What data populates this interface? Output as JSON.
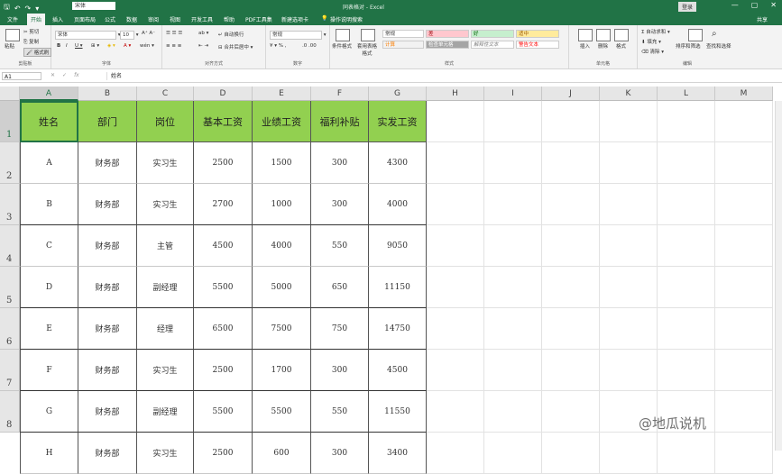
{
  "titlebar": {
    "font_name": "宋体",
    "title": "同表格对 - Excel",
    "login": "登录",
    "min": "—",
    "restore": "▢",
    "close": "✕"
  },
  "tabs": [
    "文件",
    "开始",
    "插入",
    "页面布局",
    "公式",
    "数据",
    "审阅",
    "视图",
    "开发工具",
    "帮助",
    "PDF工具集",
    "新建选项卡",
    "操作说明搜索"
  ],
  "share": "共享",
  "ribbon": {
    "clipboard": {
      "paste": "粘贴",
      "cut": "剪切",
      "copy": "复制",
      "format_painter": "格式刷",
      "label": "剪贴板"
    },
    "font": {
      "name": "宋体",
      "size": "10",
      "label": "字体"
    },
    "alignment": {
      "wrap": "自动换行",
      "merge": "合并后居中",
      "label": "对齐方式"
    },
    "number": {
      "format": "常规",
      "label": "数字"
    },
    "styles": {
      "cond_format": "条件格式",
      "table_format": "套用表格格式",
      "label": "样式",
      "boxes": [
        {
          "text": "常规",
          "color": "#ffffff"
        },
        {
          "text": "差",
          "color": "#ffc7ce"
        },
        {
          "text": "好",
          "color": "#c6efce"
        },
        {
          "text": "适中",
          "color": "#ffeb9c"
        },
        {
          "text": "计算",
          "color": "#f2f2f2"
        },
        {
          "text": "检查单元格",
          "color": "#a5a5a5"
        },
        {
          "text": "解释性文本",
          "color": "#ffffff"
        },
        {
          "text": "警告文本",
          "color": "#ffffff"
        }
      ]
    },
    "cells": {
      "insert": "插入",
      "delete": "删除",
      "format": "格式",
      "label": "单元格"
    },
    "editing": {
      "autosum": "自动求和",
      "fill": "填充",
      "clear": "清除",
      "sort": "排序和筛选",
      "find": "查找和选择",
      "label": "编辑"
    }
  },
  "formula_bar": {
    "name_box": "A1",
    "cancel": "✕",
    "enter": "✓",
    "fx": "fx",
    "content": "姓名"
  },
  "columns": [
    "A",
    "B",
    "C",
    "D",
    "E",
    "F",
    "G",
    "H",
    "I",
    "J",
    "K",
    "L",
    "M"
  ],
  "row_labels": [
    "1",
    "2",
    "3",
    "4",
    "5",
    "6",
    "7",
    "8"
  ],
  "table": {
    "headers": [
      "姓名",
      "部门",
      "岗位",
      "基本工资",
      "业绩工资",
      "福利补贴",
      "实发工资"
    ],
    "rows": [
      [
        "A",
        "财务部",
        "实习生",
        "2500",
        "1500",
        "300",
        "4300"
      ],
      [
        "B",
        "财务部",
        "实习生",
        "2700",
        "1000",
        "300",
        "4000"
      ],
      [
        "C",
        "财务部",
        "主管",
        "4500",
        "4000",
        "550",
        "9050"
      ],
      [
        "D",
        "财务部",
        "副经理",
        "5500",
        "5000",
        "650",
        "11150"
      ],
      [
        "E",
        "财务部",
        "经理",
        "6500",
        "7500",
        "750",
        "14750"
      ],
      [
        "F",
        "财务部",
        "实习生",
        "2500",
        "1700",
        "300",
        "4500"
      ],
      [
        "G",
        "财务部",
        "副经理",
        "5500",
        "5500",
        "550",
        "11550"
      ],
      [
        "H",
        "财务部",
        "实习生",
        "2500",
        "600",
        "300",
        "3400"
      ]
    ]
  },
  "watermark": "@地瓜说机"
}
